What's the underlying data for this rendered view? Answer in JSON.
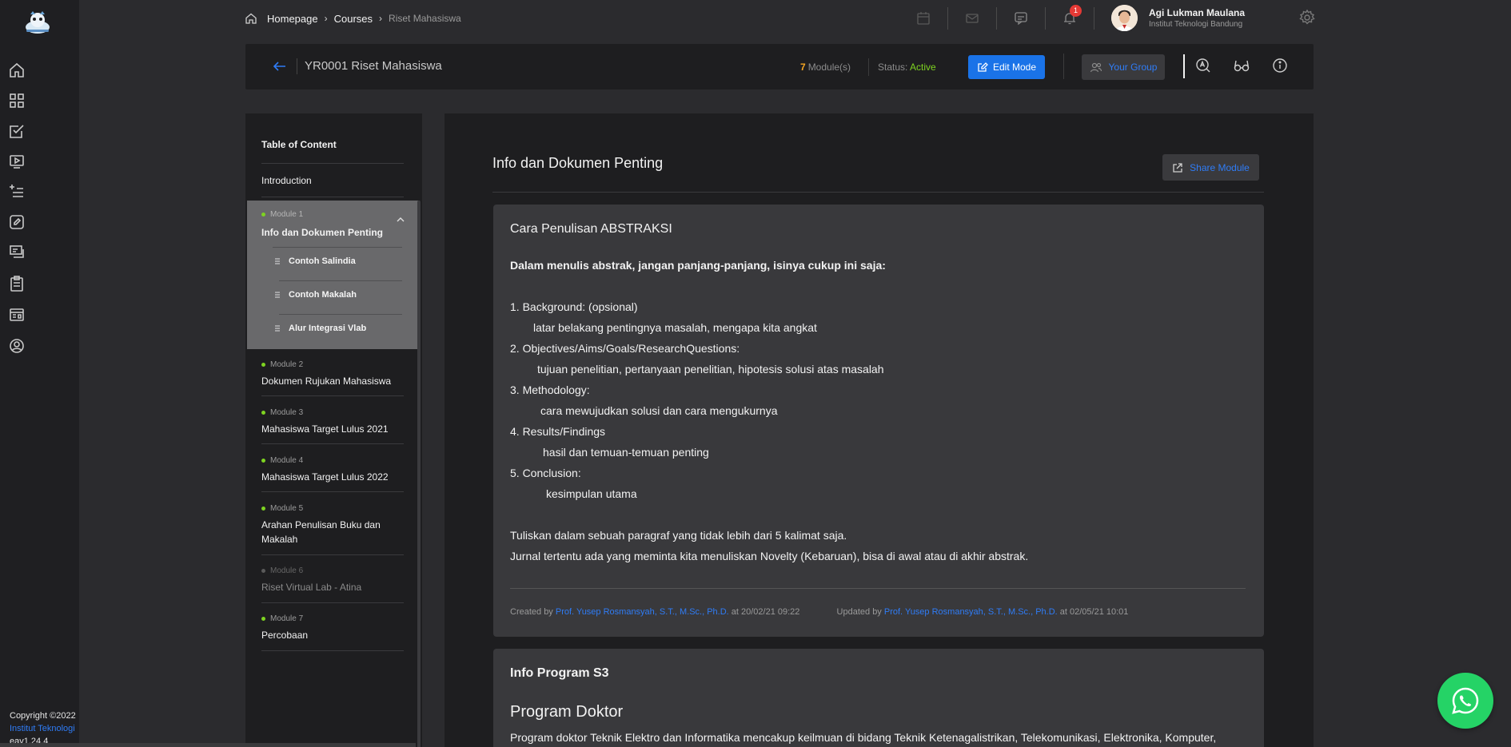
{
  "rail": {
    "items": [
      "home",
      "dashboard",
      "tasks",
      "video-class",
      "add-list",
      "edit",
      "forum",
      "clipboard",
      "calendar-card",
      "profile"
    ],
    "copyright": "Copyright ©2022",
    "institution": "Institut Teknologi",
    "version": "eav1.24.4"
  },
  "breadcrumb": {
    "items": [
      "Homepage",
      "Courses",
      "Riset Mahasiswa"
    ]
  },
  "topbar": {
    "notification_count": "1",
    "user_name": "Agi Lukman Maulana",
    "user_institution": "Institut Teknologi Bandung"
  },
  "course": {
    "title": "YR0001 Riset Mahasiswa",
    "module_count": "7",
    "module_count_label": "Module(s)",
    "status_label": "Status:",
    "status_value": "Active",
    "edit_label": "Edit Mode",
    "group_label": "Your Group"
  },
  "toc": {
    "heading": "Table of Content",
    "introduction": "Introduction",
    "modules": [
      {
        "label": "Module 1",
        "title": "Info dan Dokumen Penting"
      },
      {
        "label": "Module 2",
        "title": "Dokumen Rujukan Mahasiswa"
      },
      {
        "label": "Module 3",
        "title": "Mahasiswa Target Lulus 2021"
      },
      {
        "label": "Module 4",
        "title": "Mahasiswa Target Lulus 2022"
      },
      {
        "label": "Module 5",
        "title": "Arahan Penulisan Buku dan Makalah"
      },
      {
        "label": "Module 6",
        "title": "Riset Virtual Lab - Atina"
      },
      {
        "label": "Module 7",
        "title": "Percobaan"
      }
    ],
    "sub_items": [
      "Contoh Salindia",
      "Contoh Makalah",
      "Alur Integrasi Vlab"
    ]
  },
  "main": {
    "title": "Info dan Dokumen Penting",
    "share_label": "Share Module",
    "card1": {
      "title": "Cara Penulisan ABSTRAKSI",
      "intro": "Dalam menulis abstrak, jangan panjang-panjang, isinya cukup ini saja:",
      "lines": [
        "1. Background: (opsional)",
        "latar belakang pentingnya masalah, mengapa kita angkat",
        "2. Objectives/Aims/Goals/ResearchQuestions:",
        "tujuan penelitian, pertanyaan penelitian, hipotesis solusi atas masalah",
        "3. Methodology:",
        "cara mewujudkan solusi dan cara mengukurnya",
        "4. Results/Findings",
        "hasil dan temuan-temuan penting",
        "5. Conclusion:",
        "kesimpulan utama"
      ],
      "closing1": "Tuliskan dalam sebuah paragraf yang tidak lebih dari 5 kalimat saja.",
      "closing2": "Jurnal tertentu ada yang meminta kita menuliskan Novelty (Kebaruan), bisa di awal atau di akhir abstrak.",
      "created_prefix": "Created by",
      "created_by": "Prof. Yusep Rosmansyah, S.T., M.Sc., Ph.D.",
      "created_at": "at 20/02/21 09:22",
      "updated_prefix": "Updated by",
      "updated_by": "Prof. Yusep Rosmansyah, S.T., M.Sc., Ph.D.",
      "updated_at": "at 02/05/21 10:01"
    },
    "card2": {
      "title": "Info Program S3",
      "heading": "Program Doktor",
      "text": "Program doktor Teknik Elektro dan Informatika  mencakup keilmuan di bidang Teknik Ketenagalistrikan, Telekomunikasi, Elektronika, Komputer,"
    }
  },
  "colors": {
    "accent": "#1a73e8",
    "link": "#2f7cf6",
    "active_status": "#7ed321",
    "module_count": "#f5a623",
    "whatsapp": "#25d366"
  }
}
